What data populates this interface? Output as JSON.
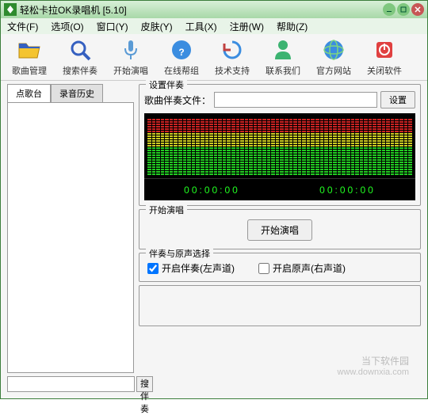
{
  "window": {
    "title": "轻松卡拉OK录唱机 [5.10]"
  },
  "menu": {
    "file": "文件(F)",
    "options": "选项(O)",
    "window": "窗口(Y)",
    "skin": "皮肤(Y)",
    "tools": "工具(X)",
    "register": "注册(W)",
    "help": "帮助(Z)"
  },
  "toolbar": {
    "songs": "歌曲管理",
    "search": "搜索伴奏",
    "sing": "开始演唱",
    "help": "在线帮组",
    "support": "技术支持",
    "contact": "联系我们",
    "website": "官方网站",
    "close": "关闭软件"
  },
  "tabs": {
    "request": "点歌台",
    "history": "录音历史"
  },
  "left": {
    "search_btn": "搜伴奏"
  },
  "groups": {
    "accomp_setup": "设置伴奏",
    "file_label": "歌曲伴奏文件：",
    "file_btn": "设置",
    "start_sing": "开始演唱",
    "start_btn": "开始演唱",
    "track_select": "伴奏与原声选择",
    "accomp_on": "开启伴奏(左声道)",
    "vocal_on": "开启原声(右声道)"
  },
  "spectrum": {
    "time_left": "00:00:00",
    "time_right": "00:00:00"
  },
  "watermark": {
    "main": "当下软件园",
    "sub": "www.downxia.com"
  }
}
